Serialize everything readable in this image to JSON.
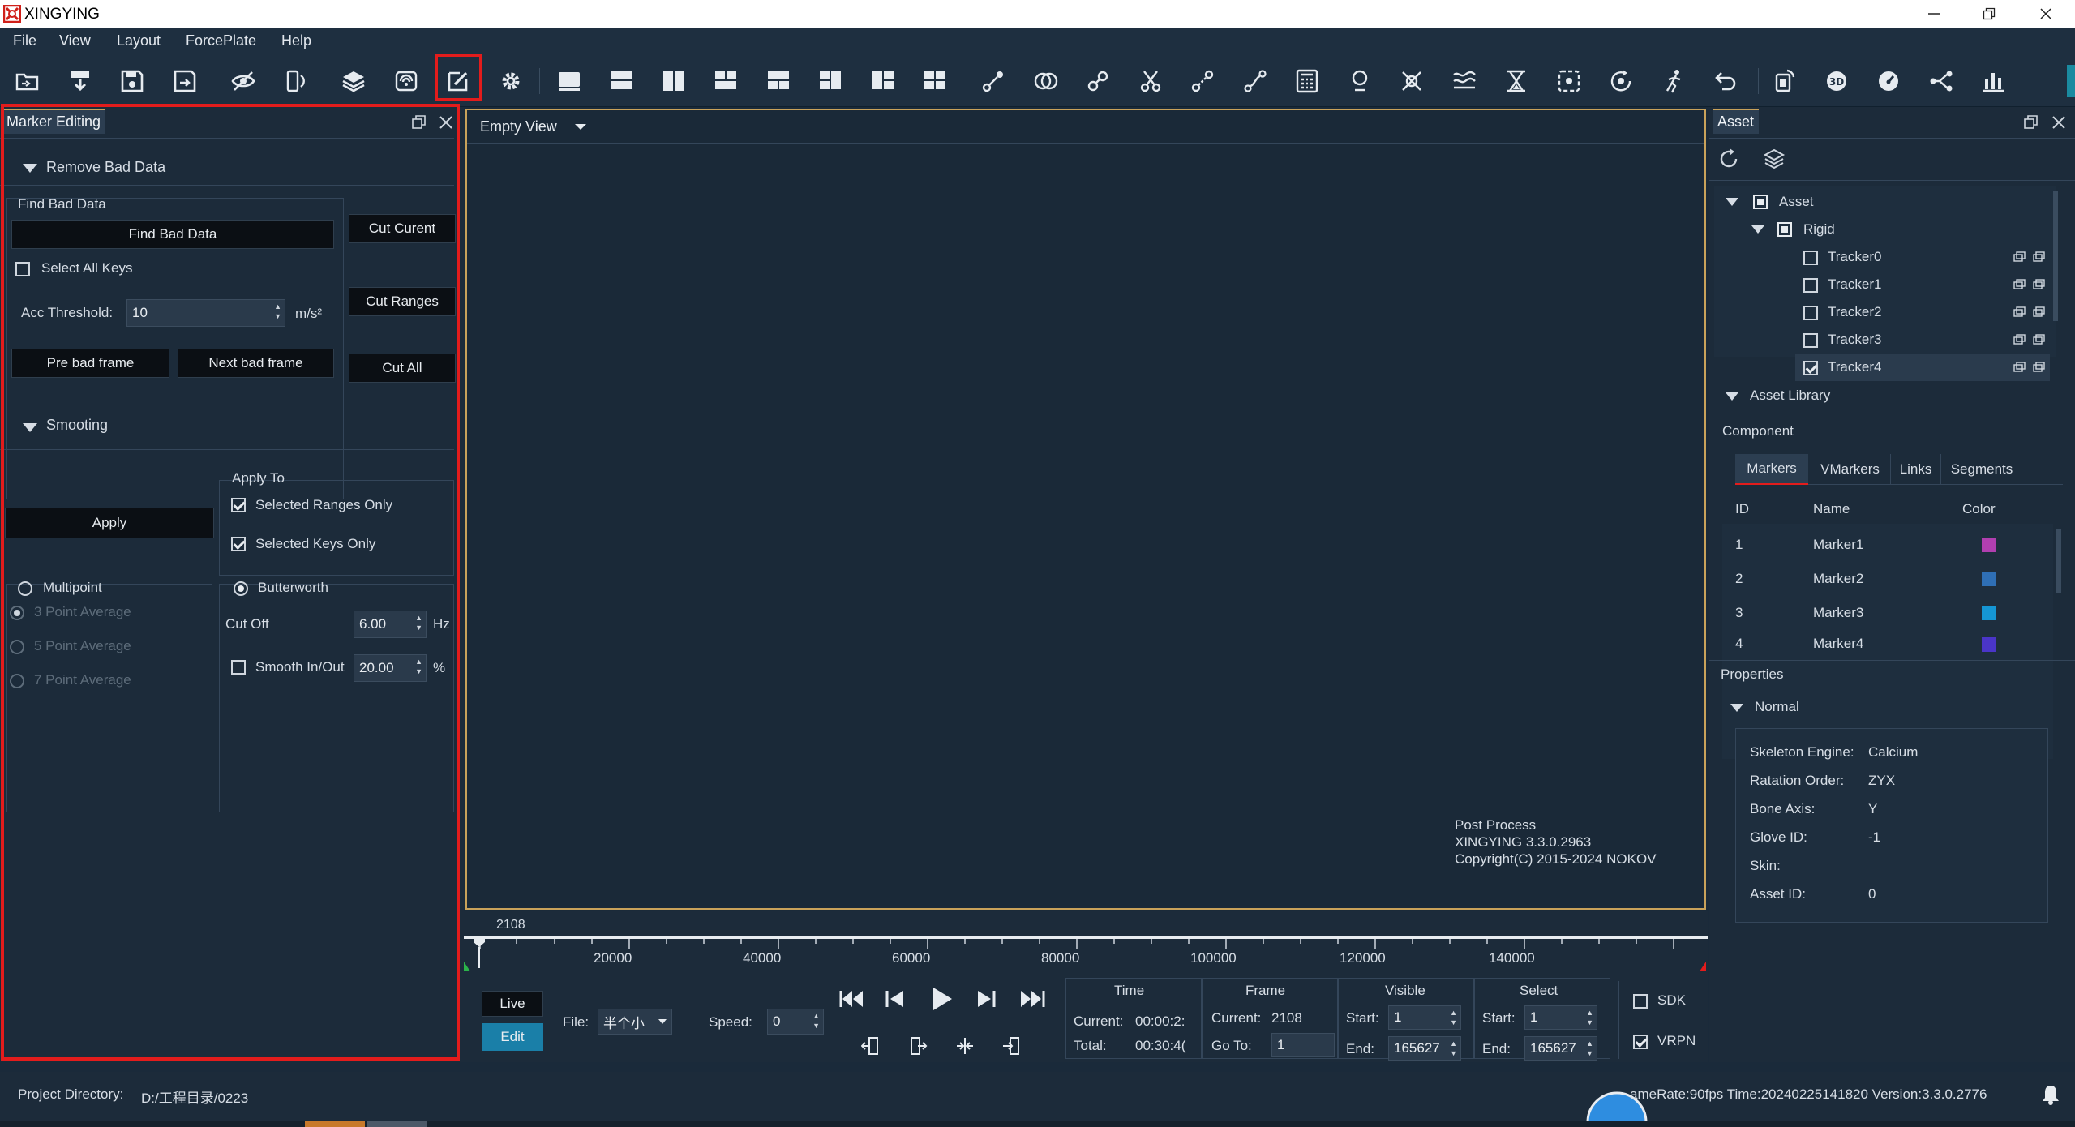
{
  "app": {
    "title": "XINGYING"
  },
  "menu": [
    "File",
    "View",
    "Layout",
    "ForcePlate",
    "Help"
  ],
  "marker_panel": {
    "tab": "Marker Editing",
    "remove_bad_data": "Remove Bad Data",
    "find_bad_data_group": "Find Bad Data",
    "find_bad_data_btn": "Find Bad Data",
    "cut_current": "Cut Curent",
    "select_all_keys": "Select All Keys",
    "cut_ranges": "Cut Ranges",
    "acc_threshold_label": "Acc Threshold:",
    "acc_threshold_value": "10",
    "acc_unit": "m/s²",
    "pre_bad_frame": "Pre bad frame",
    "next_bad_frame": "Next bad frame",
    "cut_all": "Cut All",
    "smooting": "Smooting",
    "apply_to": "Apply To",
    "selected_ranges_only": "Selected Ranges Only",
    "apply_btn": "Apply",
    "selected_keys_only": "Selected Keys Only",
    "multipoint": "Multipoint",
    "butterworth": "Butterworth",
    "point3": "3 Point Average",
    "cut_off": "Cut Off",
    "cut_off_value": "6.00",
    "hz": "Hz",
    "point5": "5 Point Average",
    "smooth_inout": "Smooth In/Out",
    "smooth_value": "20.00",
    "pct": "%",
    "point7": "7 Point Average"
  },
  "view": {
    "dropdown": "Empty View",
    "info1": "Post Process",
    "info2": "XINGYING 3.3.0.2963",
    "info3": "Copyright(C) 2015-2024 NOKOV"
  },
  "timeline": {
    "current_marker": "2108",
    "ticks": [
      "20000",
      "40000",
      "60000",
      "80000",
      "100000",
      "120000",
      "140000"
    ]
  },
  "transport": {
    "live": "Live",
    "edit": "Edit",
    "file_label": "File:",
    "file_value": "半个小",
    "speed_label": "Speed:",
    "speed_value": "0",
    "time_hdr": "Time",
    "current_label": "Current:",
    "current_time": "00:00:2:",
    "total_label": "Total:",
    "total_time": "00:30:4(",
    "frame_hdr": "Frame",
    "frame_current_label": "Current:",
    "frame_current": "2108",
    "goto_label": "Go To:",
    "goto_value": "1",
    "visible_hdr": "Visible",
    "start_label": "Start:",
    "visible_start": "1",
    "end_label": "End:",
    "visible_end": "165627",
    "select_hdr": "Select",
    "select_start": "1",
    "select_end": "165627",
    "sdk": "SDK",
    "vrpn": "VRPN"
  },
  "asset_panel": {
    "tab": "Asset",
    "tree": {
      "asset": "Asset",
      "rigid": "Rigid",
      "trackers": [
        "Tracker0",
        "Tracker1",
        "Tracker2",
        "Tracker3",
        "Tracker4"
      ],
      "library": "Asset Library"
    },
    "component": "Component",
    "tabs": [
      "Markers",
      "VMarkers",
      "Links",
      "Segments"
    ],
    "columns": [
      "ID",
      "Name",
      "Color"
    ],
    "markers": [
      {
        "id": "1",
        "name": "Marker1",
        "color": "#b13fb0"
      },
      {
        "id": "2",
        "name": "Marker2",
        "color": "#2f6fb5"
      },
      {
        "id": "3",
        "name": "Marker3",
        "color": "#1596d4"
      },
      {
        "id": "4",
        "name": "Marker4",
        "color": "#4a35c8"
      }
    ],
    "properties": "Properties",
    "normal": "Normal",
    "props": [
      {
        "k": "Skeleton Engine:",
        "v": "Calcium"
      },
      {
        "k": "Ratation Order:",
        "v": "ZYX"
      },
      {
        "k": "Bone Axis:",
        "v": "Y"
      },
      {
        "k": "Glove ID:",
        "v": "-1"
      },
      {
        "k": "Skin:",
        "v": ""
      },
      {
        "k": "Asset ID:",
        "v": "0"
      }
    ]
  },
  "status": {
    "project_label": "Project Directory:",
    "project_path": "D:/工程目录/0223",
    "info": "ameRate:90fps  Time:20240225141820  Version:3.3.0.2776"
  },
  "colors": {
    "accent_red": "#e31c1c",
    "edit_btn": "#1a7fa8",
    "panel_bg": "#1c2b3a"
  }
}
